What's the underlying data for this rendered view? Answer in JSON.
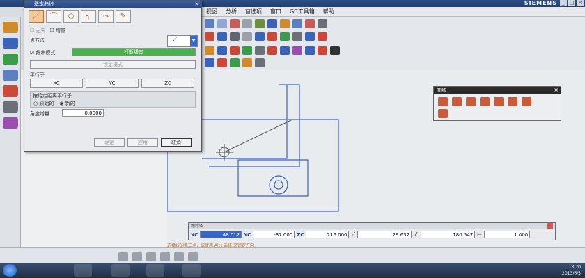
{
  "window": {
    "brand": "SIEMENS"
  },
  "menubar": {
    "items": [
      "视图",
      "分析",
      "首选项",
      "窗口",
      "GC工具箱",
      "帮助"
    ]
  },
  "dialog": {
    "title": "基本曲线",
    "close": "×",
    "chk_infinite": "无界",
    "chk_incremental": "增量",
    "point_method_label": "点方法",
    "chk_string_mode": "线串模式",
    "break_string_button": "打断线串",
    "lock_mode_button": "锁定模式",
    "parallel_label": "平行于",
    "xc_button": "XC",
    "yc_button": "YC",
    "zc_button": "ZC",
    "parallel_by_label": "按给定距离平行于",
    "radio_original": "原始的",
    "radio_new": "新的",
    "angle_label": "角度增量",
    "angle_value": "0.0000",
    "ok_button": "确定",
    "apply_button": "应用",
    "cancel_button": "取消"
  },
  "curve_panel": {
    "title": "曲线",
    "close": "×"
  },
  "tracking": {
    "title": "跟踪条",
    "xc_label": "XC",
    "xc_value": "48.012",
    "yc_label": "YC",
    "yc_value": "-37.000",
    "zc_label": "ZC",
    "zc_value": "216.000",
    "length_value": "29.632",
    "angle_value": "180.547",
    "offset_value": "1.000"
  },
  "cue": "选择线的第二点，或使用 Alt+选择 来锁定方向",
  "taskbar": {
    "time": "13:20",
    "date": "2013/6/5"
  },
  "colors": {
    "title_bar": "#2f4f86",
    "accent": "#3568c8",
    "geometry": "#3a5fcf"
  }
}
